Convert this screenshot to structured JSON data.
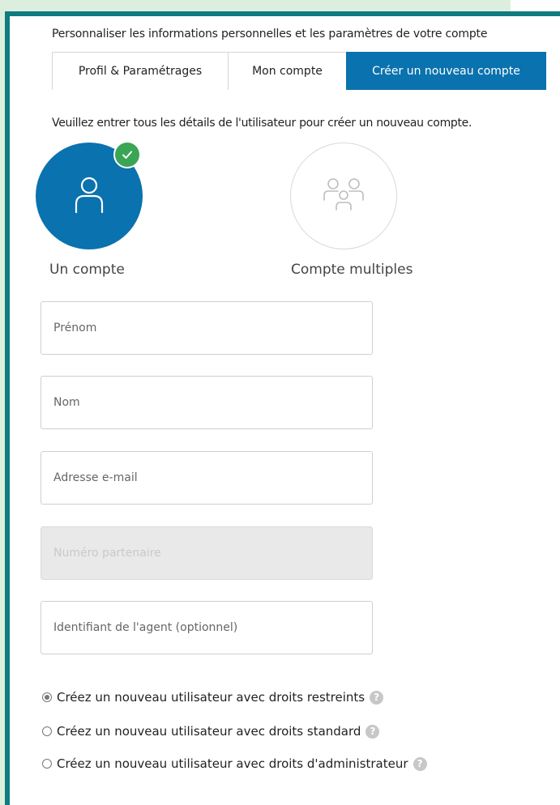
{
  "intro_text": "Personnaliser les informations personnelles et les paramètres de votre compte",
  "tabs": [
    {
      "label": "Profil & Paramétrages",
      "active": false
    },
    {
      "label": "Mon compte",
      "active": false
    },
    {
      "label": "Créer un nouveau compte",
      "active": true
    }
  ],
  "subtitle": "Veuillez entrer tous les détails de l'utilisateur pour créer un nouveau compte.",
  "account_types": [
    {
      "label": "Un compte",
      "icon": "single-user-icon",
      "selected": true
    },
    {
      "label": "Compte multiples",
      "icon": "multiple-users-icon",
      "selected": false
    }
  ],
  "fields": {
    "first_name": {
      "placeholder": "Prénom",
      "value": ""
    },
    "last_name": {
      "placeholder": "Nom",
      "value": ""
    },
    "email": {
      "placeholder": "Adresse e-mail",
      "value": ""
    },
    "partner_number": {
      "placeholder": "Numéro partenaire",
      "value": "",
      "disabled": true
    },
    "agent_id": {
      "placeholder": "Identifiant de l'agent (optionnel)",
      "value": ""
    }
  },
  "rights_options": [
    {
      "label": "Créez un nouveau utilisateur avec droits restreints",
      "checked": true
    },
    {
      "label": "Créez un nouveau utilisateur avec droits standard",
      "checked": false
    },
    {
      "label": "Créez un nouveau utilisateur avec droits d'administrateur",
      "checked": false
    }
  ],
  "help_glyph": "?",
  "colors": {
    "accent_blue": "#0a72ae",
    "border_teal": "#0e7c80",
    "background_green": "#dcefdf",
    "check_green": "#3aa655"
  }
}
